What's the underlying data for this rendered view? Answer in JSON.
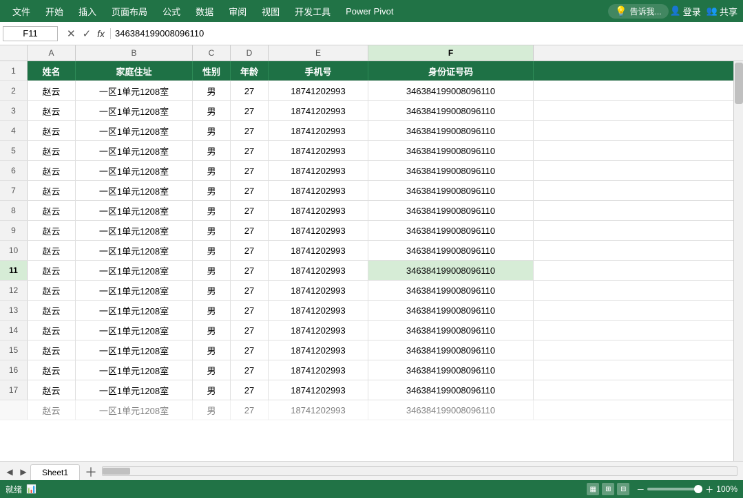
{
  "menubar": {
    "items": [
      "文件",
      "开始",
      "插入",
      "页面布局",
      "公式",
      "数据",
      "审阅",
      "视图",
      "开发工具",
      "Power Pivot"
    ],
    "tell_me": "告诉我...",
    "login": "登录",
    "share": "共享"
  },
  "formula_bar": {
    "cell_ref": "F11",
    "formula_value": "346384199008096110"
  },
  "columns": {
    "letters": [
      "A",
      "B",
      "C",
      "D",
      "E",
      "F"
    ],
    "headers": [
      "姓名",
      "家庭住址",
      "性别",
      "年龄",
      "手机号",
      "身份证号码"
    ]
  },
  "rows": [
    [
      "赵云",
      "一区1单元1208室",
      "男",
      "27",
      "18741202993",
      "346384199008096110"
    ],
    [
      "赵云",
      "一区1单元1208室",
      "男",
      "27",
      "18741202993",
      "346384199008096110"
    ],
    [
      "赵云",
      "一区1单元1208室",
      "男",
      "27",
      "18741202993",
      "346384199008096110"
    ],
    [
      "赵云",
      "一区1单元1208室",
      "男",
      "27",
      "18741202993",
      "346384199008096110"
    ],
    [
      "赵云",
      "一区1单元1208室",
      "男",
      "27",
      "18741202993",
      "346384199008096110"
    ],
    [
      "赵云",
      "一区1单元1208室",
      "男",
      "27",
      "18741202993",
      "346384199008096110"
    ],
    [
      "赵云",
      "一区1单元1208室",
      "男",
      "27",
      "18741202993",
      "346384199008096110"
    ],
    [
      "赵云",
      "一区1单元1208室",
      "男",
      "27",
      "18741202993",
      "346384199008096110"
    ],
    [
      "赵云",
      "一区1单元1208室",
      "男",
      "27",
      "18741202993",
      "346384199008096110"
    ],
    [
      "赵云",
      "一区1单元1208室",
      "男",
      "27",
      "18741202993",
      "346384199008096110"
    ],
    [
      "赵云",
      "一区1单元1208室",
      "男",
      "27",
      "18741202993",
      "346384199008096110"
    ],
    [
      "赵云",
      "一区1单元1208室",
      "男",
      "27",
      "18741202993",
      "346384199008096110"
    ],
    [
      "赵云",
      "一区1单元1208室",
      "男",
      "27",
      "18741202993",
      "346384199008096110"
    ],
    [
      "赵云",
      "一区1单元1208室",
      "男",
      "27",
      "18741202993",
      "346384199008096110"
    ],
    [
      "赵云",
      "一区1单元1208室",
      "男",
      "27",
      "18741202993",
      "346384199008096110"
    ],
    [
      "赵云",
      "一区1单元1208室",
      "男",
      "27",
      "18741202993",
      "346384199008096110"
    ]
  ],
  "row_numbers": [
    2,
    3,
    4,
    5,
    6,
    7,
    8,
    9,
    10,
    11,
    12,
    13,
    14,
    15,
    16,
    17
  ],
  "partial_rows": [
    [
      "赵云",
      "一区1单元1208室",
      "男",
      "27",
      "18741202993",
      "346384199008096110"
    ]
  ],
  "sheet_tabs": [
    "Sheet1"
  ],
  "status": {
    "ready": "就绪",
    "zoom": "100%"
  },
  "colors": {
    "header_bg": "#1e7145",
    "menu_bg": "#217346",
    "selected_cell": "#d6ecd6"
  }
}
